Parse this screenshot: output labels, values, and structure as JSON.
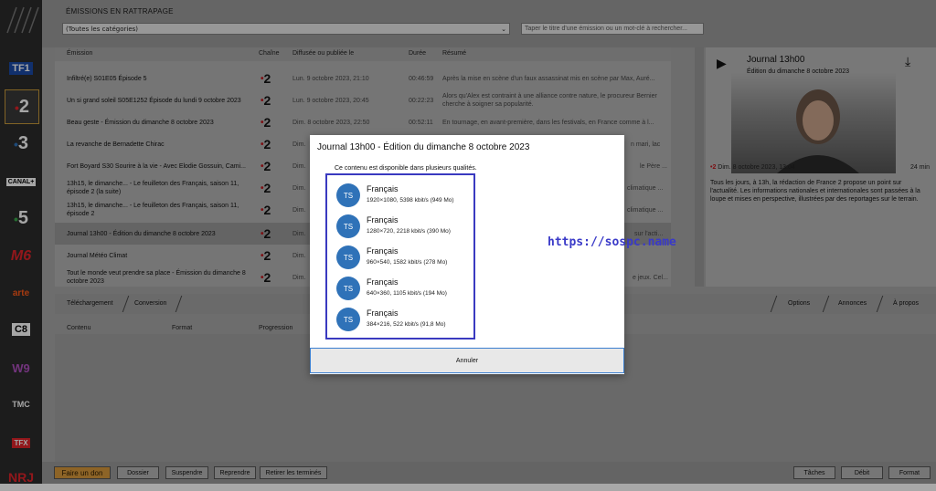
{
  "header": {
    "section_title": "ÉMISSIONS EN RATTRAPAGE",
    "category_select": "(Toutes les catégories)",
    "search_placeholder": "Taper le titre d'une émission ou un mot-clé à rechercher..."
  },
  "channels": [
    "TF1",
    "2",
    "3",
    "CANAL+",
    "5",
    "M6",
    "arte",
    "C8",
    "W9",
    "TMC",
    "TFX",
    "NRJ"
  ],
  "table": {
    "columns": [
      "Émission",
      "Chaîne",
      "Diffusée ou publiée le",
      "Durée",
      "Résumé"
    ],
    "rows": [
      {
        "title": "Infiltré(e) S01E05 Épisode 5",
        "date": "Lun. 9 octobre 2023, 21:10",
        "duration": "00:46:59",
        "summary": "Après la mise en scène d'un faux assassinat mis en scène par Max, Auré..."
      },
      {
        "title": "Un si grand soleil S05E1252 Épisode du lundi 9 octobre 2023",
        "date": "Lun. 9 octobre 2023, 20:45",
        "duration": "00:22:23",
        "summary": "Alors qu'Alex est contraint à une alliance contre nature, le procureur Bernier cherche à soigner sa popularité."
      },
      {
        "title": "Beau geste - Émission du dimanche 8 octobre 2023",
        "date": "Dim. 8 octobre 2023, 22:50",
        "duration": "00:52:11",
        "summary": "En tournage, en avant-première, dans les festivals, en France comme à l..."
      },
      {
        "title": "La revanche de Bernadette Chirac",
        "date": "Dim.",
        "duration": "",
        "summary": "n mari, lac"
      },
      {
        "title": "Fort Boyard S30 Sourire à la vie - Avec Elodie Gossuin, Cami...",
        "date": "Dim.",
        "duration": "",
        "summary": "le Père ..."
      },
      {
        "title": "13h15, le dimanche... - Le feuilleton des Français, saison 11, épisode 2 (la suite)",
        "date": "Dim.",
        "duration": "",
        "summary": "climatique ..."
      },
      {
        "title": "13h15, le dimanche... - Le feuilleton des Français, saison 11, épisode 2",
        "date": "Dim.",
        "duration": "",
        "summary": "climatique ..."
      },
      {
        "title": "Journal 13h00 - Édition du dimanche 8 octobre 2023",
        "date": "Dim.",
        "duration": "",
        "summary": "sur l'acti..."
      },
      {
        "title": "Journal Météo Climat",
        "date": "Dim.",
        "duration": "",
        "summary": ""
      },
      {
        "title": "Tout le monde veut prendre sa place - Émission du dimanche 8 octobre 2023",
        "date": "Dim.",
        "duration": "",
        "summary": "e jeux. Cel..."
      }
    ]
  },
  "preview": {
    "title": "Journal 13h00",
    "subtitle": "Édition du dimanche 8 octobre 2023",
    "meta": "Dim. 8 octobre 2023, 13:04",
    "duration": "24 min",
    "description": "Tous les jours, à 13h, la rédaction de France 2 propose un point sur l'actualité. Les informations nationales et internationales sont passées à la loupe et mises en perspective, illustrées par des reportages sur le terrain."
  },
  "tabs": {
    "left": [
      "Téléchargement",
      "Conversion"
    ],
    "right": [
      "Options",
      "Annonces",
      "À propos"
    ]
  },
  "download_columns": [
    "Contenu",
    "Format",
    "Progression"
  ],
  "bottom_buttons": {
    "donate": "Faire un don",
    "left": [
      "Dossier",
      "Suspendre",
      "Reprendre",
      "Retirer les terminés"
    ],
    "right": [
      "Tâches",
      "Débit",
      "Format"
    ]
  },
  "modal": {
    "title": "Journal 13h00 - Édition du dimanche 8 octobre 2023",
    "message": "Ce contenu est disponible dans plusieurs qualités.",
    "qualities": [
      {
        "badge": "TS",
        "language": "Français",
        "details": "1920×1080, 5398 kbit/s (949 Mo)"
      },
      {
        "badge": "TS",
        "language": "Français",
        "details": "1280×720, 2218 kbit/s (390 Mo)"
      },
      {
        "badge": "TS",
        "language": "Français",
        "details": "960×540, 1582 kbit/s (278 Mo)"
      },
      {
        "badge": "TS",
        "language": "Français",
        "details": "640×360, 1105 kbit/s (194 Mo)"
      },
      {
        "badge": "TS",
        "language": "Français",
        "details": "384×216, 522 kbit/s (91,8 Mo)"
      }
    ],
    "cancel_label": "Annuler"
  },
  "watermark": "https://sospc.name",
  "colors": {
    "accent_blue": "#2f72b8",
    "highlight_border": "#3a3ac0",
    "donate": "#d99a3c",
    "france2_red": "#c0181e"
  }
}
